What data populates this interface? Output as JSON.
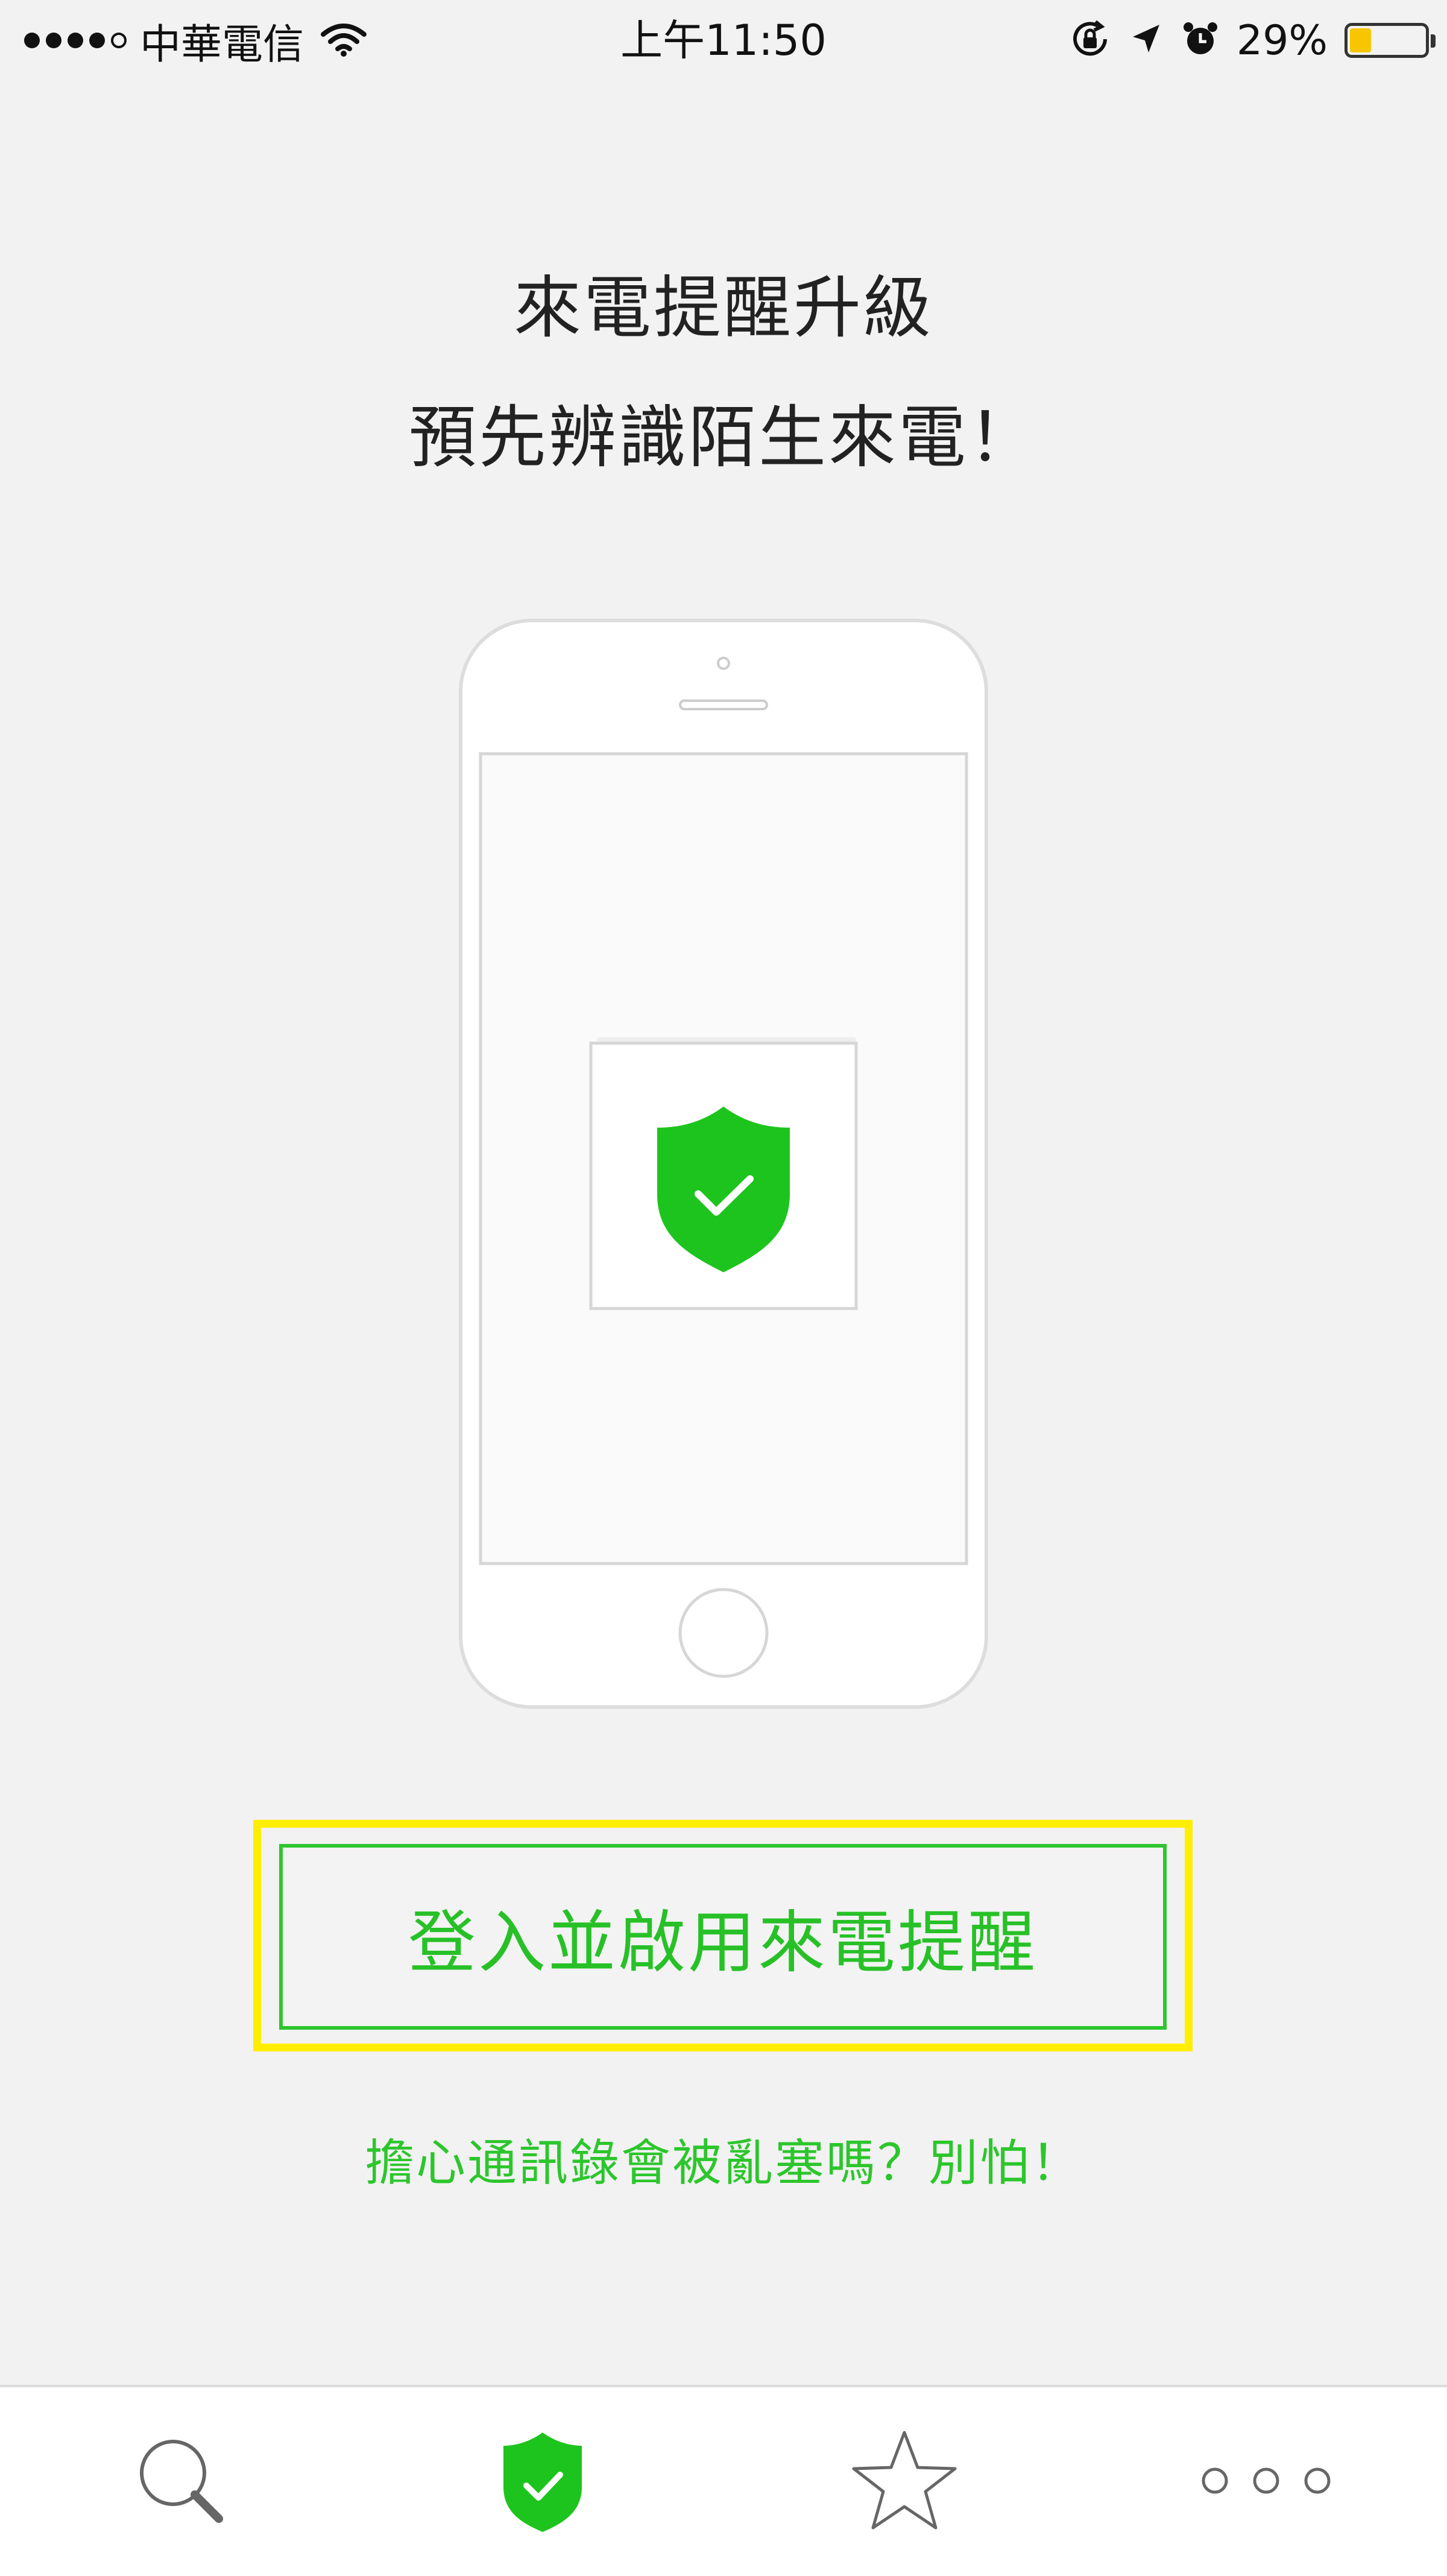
{
  "status_bar": {
    "carrier": "中華電信",
    "time": "上午11:50",
    "battery_percent": "29%",
    "battery_level": 0.29,
    "signal_bars_filled": 4,
    "signal_bars_total": 5,
    "icons": [
      "wifi-icon",
      "orientation-lock-icon",
      "location-arrow-icon",
      "alarm-icon",
      "battery-icon"
    ]
  },
  "hero": {
    "title_line1": "來電提醒升級",
    "title_line2": "預先辨識陌生來電！"
  },
  "illustration": {
    "icon": "shield-check-icon",
    "accent_color": "#1ec41e"
  },
  "cta": {
    "button_label": "登入並啟用來電提醒",
    "help_link": "擔心通訊錄會被亂塞嗎？別怕！",
    "highlight_color": "#ffee00",
    "text_color": "#27c127"
  },
  "tab_bar": {
    "tabs": [
      {
        "name": "search",
        "icon": "search-icon",
        "active": false
      },
      {
        "name": "protection",
        "icon": "shield-check-icon",
        "active": true
      },
      {
        "name": "favorites",
        "icon": "star-icon",
        "active": false
      },
      {
        "name": "more",
        "icon": "more-dots-icon",
        "active": false
      }
    ]
  }
}
